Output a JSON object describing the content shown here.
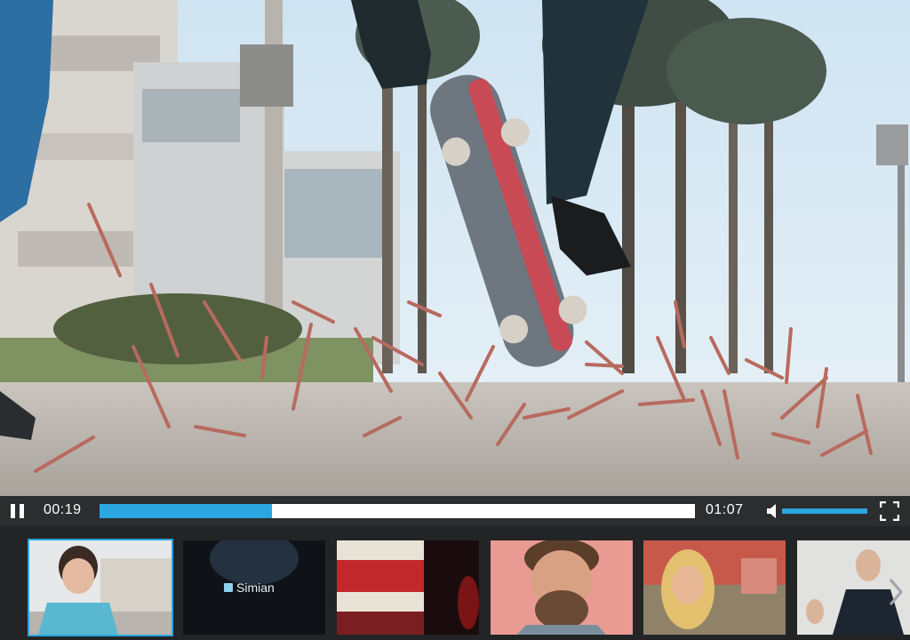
{
  "player": {
    "current_time": "00:19",
    "duration": "01:07",
    "progress_fraction": 0.29,
    "volume_fraction": 1.0,
    "state": "playing"
  },
  "icons": {
    "pause": "pause-icon",
    "volume": "volume-icon",
    "fullscreen": "fullscreen-icon",
    "next": "chevron-right-icon"
  },
  "colors": {
    "accent": "#2aa6e0",
    "control_bar": "#2b2d2f",
    "thumb_strip": "#222426"
  },
  "thumbnails": [
    {
      "id": "thumb-1",
      "active": true
    },
    {
      "id": "thumb-2",
      "label": "Simian"
    },
    {
      "id": "thumb-3"
    },
    {
      "id": "thumb-4"
    },
    {
      "id": "thumb-5"
    },
    {
      "id": "thumb-6"
    }
  ]
}
